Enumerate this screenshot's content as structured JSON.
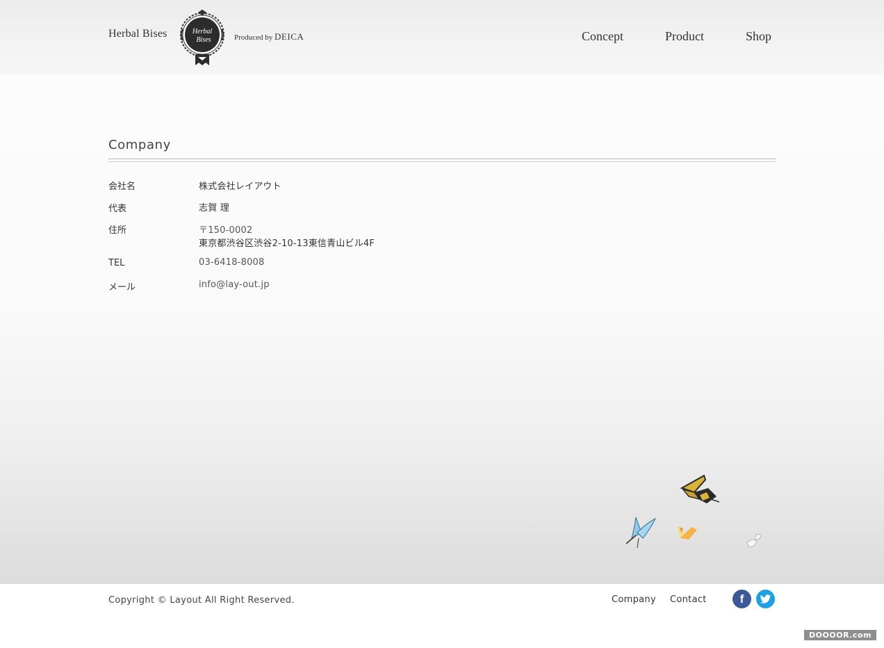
{
  "header": {
    "brand": "Herbal Bises",
    "emblem_text": "Herbal Bises",
    "produced_prefix": "Produced by",
    "produced_brand": "DEICA",
    "nav": [
      "Concept",
      "Product",
      "Shop"
    ]
  },
  "company": {
    "title": "Company",
    "rows": [
      {
        "label": "会社名",
        "value": "株式会社レイアウト"
      },
      {
        "label": "代表",
        "value": "志賀 理"
      },
      {
        "label": "住所",
        "value": "〒150-0002",
        "value2": "東京都渋谷区渋谷2-10-13東信青山ビル4F"
      },
      {
        "label": "TEL",
        "value": "03-6418-8008"
      },
      {
        "label": "メール",
        "value": "info@lay-out.jp"
      }
    ]
  },
  "footer": {
    "copyright": "Copyright © Layout All Right Reserved.",
    "links": [
      "Company",
      "Contact"
    ],
    "social": [
      {
        "icon": "facebook-icon",
        "glyph": "f",
        "color": "#3b5998"
      },
      {
        "icon": "twitter-icon",
        "color": "#1da1e2"
      }
    ]
  },
  "watermark": "DOOOOR.com"
}
